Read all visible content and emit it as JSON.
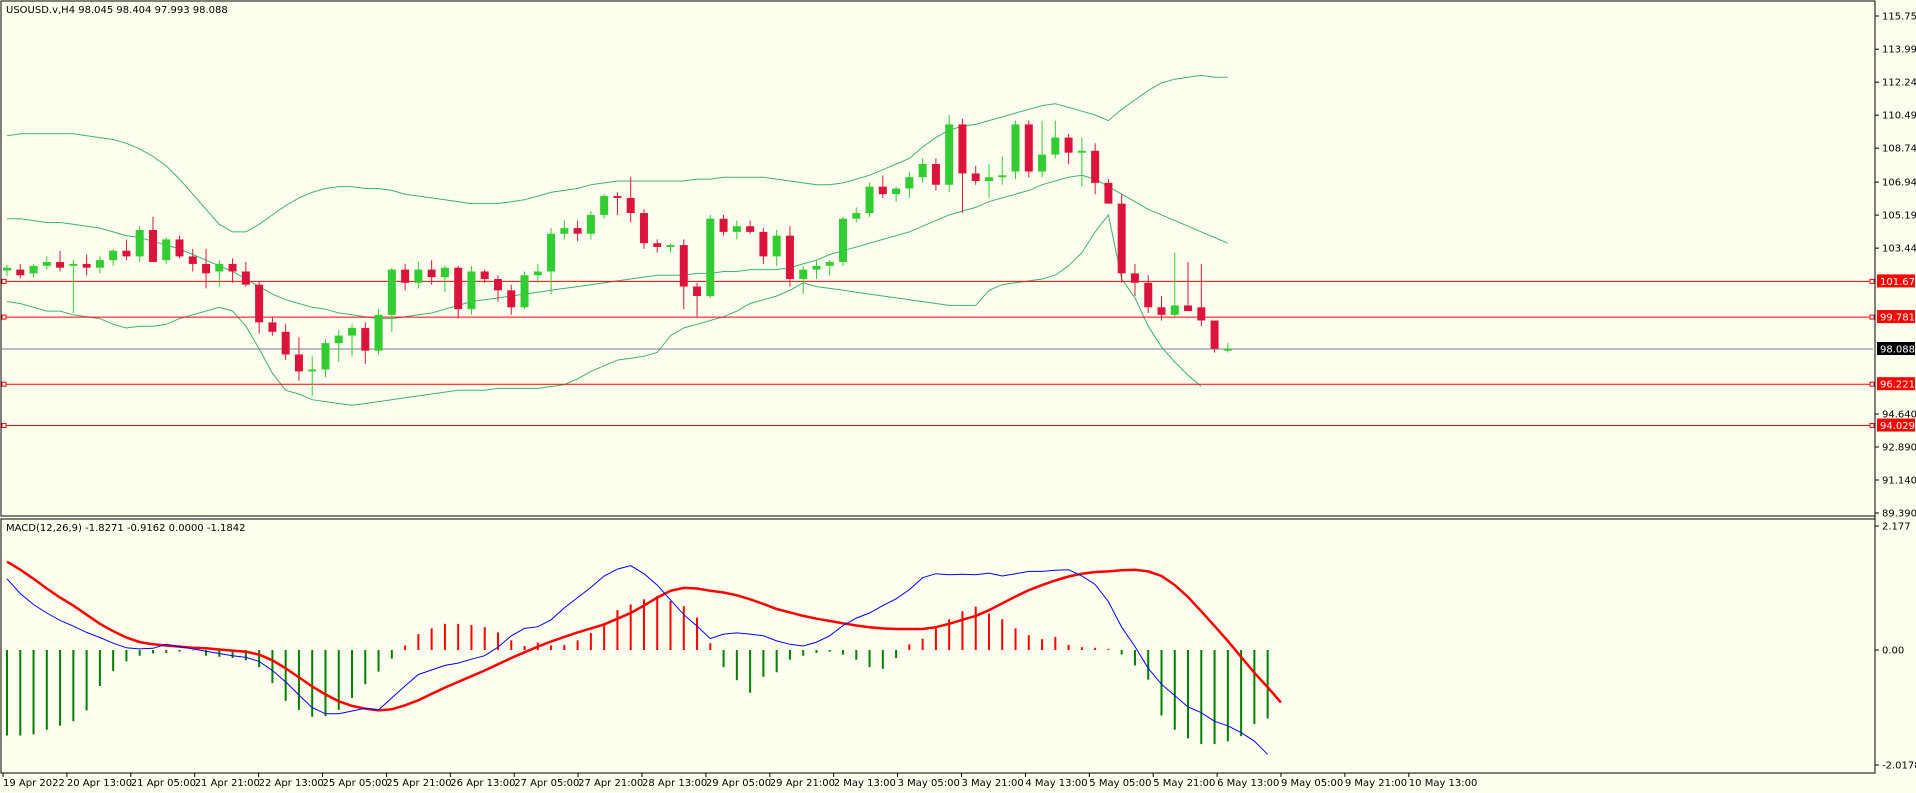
{
  "app": {
    "symbol": "USOUSD.v",
    "timeframe": "H4",
    "ohlc_readout": "98.045 98.404 97.993 98.088",
    "header_text": "USOUSD.v,H4  98.045 98.404 97.993 98.088"
  },
  "colors": {
    "background": "#FFFFF0",
    "bull_candle": "#32CD32",
    "bear_candle": "#DC143C",
    "bollinger": "#3CB371",
    "level_line": "#FF0000",
    "current_price_line": "#708090",
    "macd_line": "#0000FF",
    "signal_line": "#FF0000",
    "hist_negative": "#008000",
    "hist_positive": "#FF0000"
  },
  "price_axis": {
    "labels": [
      "115.750",
      "113.990",
      "112.240",
      "110.490",
      "108.740",
      "106.940",
      "105.190",
      "103.440",
      "101.673",
      "99.781",
      "98.088",
      "96.221",
      "94.640",
      "92.890",
      "91.140",
      "89.390"
    ],
    "range": [
      89.39,
      115.75
    ]
  },
  "levels": [
    {
      "value": 101.673,
      "label": "101.673"
    },
    {
      "value": 99.781,
      "label": "99.781"
    },
    {
      "value": 96.221,
      "label": "96.221"
    },
    {
      "value": 94.029,
      "label": "94.029"
    }
  ],
  "current_price": {
    "value": 98.088,
    "label": "98.088"
  },
  "time_axis": {
    "labels": [
      "19 Apr 2022",
      "20 Apr 13:00",
      "21 Apr 05:00",
      "21 Apr 21:00",
      "22 Apr 13:00",
      "25 Apr 05:00",
      "25 Apr 21:00",
      "26 Apr 13:00",
      "27 Apr 05:00",
      "27 Apr 21:00",
      "28 Apr 13:00",
      "29 Apr 05:00",
      "29 Apr 21:00",
      "2 May 13:00",
      "3 May 05:00",
      "3 May 21:00",
      "4 May 13:00",
      "5 May 05:00",
      "5 May 21:00",
      "6 May 13:00",
      "9 May 05:00",
      "9 May 21:00",
      "10 May 13:00"
    ]
  },
  "macd": {
    "header_text": "MACD(12,26,9) -1.8271 -0.9162 0.0000 -1.1842",
    "axis_labels": [
      "2.177",
      "0.00",
      "-2.0178"
    ],
    "range": [
      -2.0178,
      2.177
    ]
  },
  "chart_data": {
    "type": "candlestick",
    "candles": [
      [
        102.25,
        102.55,
        101.95,
        102.4
      ],
      [
        102.3,
        102.6,
        101.85,
        102.0
      ],
      [
        102.1,
        102.6,
        101.9,
        102.5
      ],
      [
        102.5,
        103.0,
        102.3,
        102.7
      ],
      [
        102.7,
        103.3,
        102.2,
        102.4
      ],
      [
        102.5,
        102.8,
        100.0,
        102.6
      ],
      [
        102.6,
        103.1,
        102.0,
        102.4
      ],
      [
        102.4,
        103.0,
        102.1,
        102.8
      ],
      [
        102.8,
        103.4,
        102.5,
        103.3
      ],
      [
        103.3,
        103.9,
        102.8,
        103.0
      ],
      [
        103.0,
        104.6,
        102.7,
        104.4
      ],
      [
        104.4,
        105.1,
        102.7,
        102.7
      ],
      [
        102.8,
        104.0,
        102.6,
        103.9
      ],
      [
        103.9,
        104.1,
        102.9,
        103.0
      ],
      [
        103.0,
        103.4,
        102.2,
        102.6
      ],
      [
        102.6,
        103.4,
        101.3,
        102.1
      ],
      [
        102.2,
        102.8,
        101.4,
        102.6
      ],
      [
        102.6,
        102.9,
        101.6,
        102.2
      ],
      [
        102.2,
        102.7,
        101.4,
        101.5
      ],
      [
        101.5,
        101.7,
        98.9,
        99.5
      ],
      [
        99.5,
        99.8,
        98.8,
        99.0
      ],
      [
        99.0,
        99.4,
        97.5,
        97.8
      ],
      [
        97.8,
        98.7,
        96.4,
        96.9
      ],
      [
        96.9,
        97.7,
        95.6,
        97.0
      ],
      [
        97.0,
        98.6,
        96.6,
        98.4
      ],
      [
        98.4,
        99.1,
        97.4,
        98.8
      ],
      [
        98.8,
        99.4,
        97.7,
        99.2
      ],
      [
        99.2,
        99.5,
        97.3,
        98.0
      ],
      [
        98.0,
        100.2,
        97.8,
        99.9
      ],
      [
        99.9,
        102.4,
        99.0,
        102.3
      ],
      [
        102.3,
        102.6,
        101.2,
        101.6
      ],
      [
        101.6,
        102.7,
        101.3,
        102.3
      ],
      [
        102.3,
        102.8,
        101.5,
        101.9
      ],
      [
        101.9,
        102.5,
        101.1,
        102.4
      ],
      [
        102.4,
        102.5,
        99.7,
        100.2
      ],
      [
        100.2,
        102.5,
        99.9,
        102.2
      ],
      [
        102.2,
        102.3,
        101.6,
        101.8
      ],
      [
        101.8,
        102.0,
        100.6,
        101.2
      ],
      [
        101.2,
        101.5,
        99.9,
        100.3
      ],
      [
        100.3,
        102.2,
        100.2,
        102.0
      ],
      [
        102.0,
        102.6,
        101.6,
        102.2
      ],
      [
        102.2,
        104.5,
        101.0,
        104.2
      ],
      [
        104.2,
        104.9,
        103.9,
        104.5
      ],
      [
        104.5,
        104.9,
        103.8,
        104.2
      ],
      [
        104.2,
        105.4,
        103.9,
        105.2
      ],
      [
        105.2,
        106.3,
        105.0,
        106.2
      ],
      [
        106.2,
        106.4,
        105.2,
        106.1
      ],
      [
        106.1,
        107.2,
        104.8,
        105.3
      ],
      [
        105.3,
        105.5,
        103.4,
        103.7
      ],
      [
        103.7,
        103.9,
        103.2,
        103.5
      ],
      [
        103.5,
        103.7,
        103.2,
        103.6
      ],
      [
        103.6,
        103.9,
        100.2,
        101.4
      ],
      [
        101.4,
        101.6,
        99.8,
        100.9
      ],
      [
        100.9,
        105.2,
        100.8,
        105.0
      ],
      [
        105.0,
        105.2,
        104.1,
        104.3
      ],
      [
        104.3,
        104.9,
        103.9,
        104.6
      ],
      [
        104.6,
        104.9,
        104.2,
        104.3
      ],
      [
        104.3,
        104.5,
        102.6,
        103.0
      ],
      [
        103.0,
        104.4,
        102.5,
        104.1
      ],
      [
        104.1,
        104.6,
        101.4,
        101.8
      ],
      [
        101.8,
        102.5,
        101.0,
        102.3
      ],
      [
        102.3,
        102.8,
        101.8,
        102.5
      ],
      [
        102.5,
        102.8,
        102.0,
        102.7
      ],
      [
        102.7,
        105.1,
        102.5,
        105.0
      ],
      [
        105.0,
        105.6,
        104.8,
        105.3
      ],
      [
        105.3,
        106.9,
        105.1,
        106.7
      ],
      [
        106.7,
        107.3,
        106.1,
        106.3
      ],
      [
        106.3,
        106.7,
        105.9,
        106.6
      ],
      [
        106.6,
        107.5,
        106.1,
        107.2
      ],
      [
        107.2,
        108.2,
        106.9,
        107.9
      ],
      [
        107.9,
        108.2,
        106.5,
        106.8
      ],
      [
        106.8,
        110.5,
        106.4,
        110.0
      ],
      [
        110.0,
        110.3,
        105.3,
        107.4
      ],
      [
        107.4,
        107.8,
        106.8,
        107.0
      ],
      [
        107.0,
        107.9,
        106.1,
        107.2
      ],
      [
        107.2,
        108.3,
        106.8,
        107.3
      ],
      [
        107.5,
        110.2,
        107.1,
        110.0
      ],
      [
        110.0,
        110.2,
        107.2,
        107.5
      ],
      [
        107.5,
        110.2,
        107.2,
        108.4
      ],
      [
        108.4,
        110.2,
        108.2,
        109.3
      ],
      [
        109.3,
        109.5,
        107.9,
        108.5
      ],
      [
        108.5,
        109.3,
        106.7,
        108.6
      ],
      [
        108.6,
        109.0,
        106.3,
        106.9
      ],
      [
        106.9,
        107.1,
        105.8,
        105.8
      ],
      [
        105.8,
        106.3,
        101.6,
        102.1
      ],
      [
        102.1,
        102.6,
        100.9,
        101.6
      ],
      [
        101.6,
        102.0,
        100.0,
        100.3
      ],
      [
        100.3,
        100.9,
        99.6,
        99.9
      ],
      [
        99.9,
        103.2,
        99.8,
        100.4
      ],
      [
        100.4,
        102.7,
        100.2,
        100.1
      ],
      [
        100.3,
        102.6,
        99.3,
        99.6
      ],
      [
        99.6,
        99.6,
        97.9,
        98.1
      ],
      [
        98.0,
        98.4,
        97.9,
        98.088
      ]
    ],
    "macd": [
      1.25,
      0.99,
      0.8,
      0.65,
      0.52,
      0.42,
      0.31,
      0.22,
      0.12,
      0.04,
      0.02,
      0.03,
      0.1,
      0.06,
      0.02,
      -0.02,
      -0.06,
      -0.1,
      -0.13,
      -0.2,
      -0.36,
      -0.56,
      -0.79,
      -1.01,
      -1.12,
      -1.12,
      -1.07,
      -1.02,
      -1.05,
      -0.84,
      -0.63,
      -0.43,
      -0.35,
      -0.27,
      -0.23,
      -0.16,
      -0.1,
      0.05,
      0.25,
      0.38,
      0.41,
      0.53,
      0.74,
      0.92,
      1.1,
      1.3,
      1.42,
      1.48,
      1.34,
      1.14,
      0.88,
      0.62,
      0.42,
      0.2,
      0.28,
      0.3,
      0.28,
      0.25,
      0.16,
      0.1,
      0.07,
      0.14,
      0.25,
      0.43,
      0.56,
      0.65,
      0.78,
      0.9,
      1.06,
      1.27,
      1.34,
      1.32,
      1.33,
      1.32,
      1.35,
      1.3,
      1.34,
      1.38,
      1.38,
      1.4,
      1.41,
      1.3,
      1.15,
      0.85,
      0.4,
      0.06,
      -0.32,
      -0.6,
      -0.8,
      -1.0,
      -1.1,
      -1.25,
      -1.33,
      -1.45,
      -1.6,
      -1.83
    ],
    "signal": [
      1.55,
      1.41,
      1.25,
      1.08,
      0.92,
      0.78,
      0.62,
      0.46,
      0.33,
      0.22,
      0.14,
      0.1,
      0.08,
      0.06,
      0.04,
      0.03,
      0.01,
      -0.01,
      -0.03,
      -0.08,
      -0.18,
      -0.32,
      -0.48,
      -0.64,
      -0.78,
      -0.9,
      -0.98,
      -1.03,
      -1.06,
      -1.04,
      -0.97,
      -0.88,
      -0.77,
      -0.66,
      -0.56,
      -0.46,
      -0.36,
      -0.25,
      -0.14,
      -0.04,
      0.06,
      0.15,
      0.23,
      0.31,
      0.38,
      0.45,
      0.55,
      0.65,
      0.78,
      0.92,
      1.04,
      1.09,
      1.08,
      1.04,
      1.01,
      0.96,
      0.89,
      0.81,
      0.72,
      0.66,
      0.6,
      0.55,
      0.51,
      0.47,
      0.43,
      0.4,
      0.38,
      0.37,
      0.37,
      0.37,
      0.4,
      0.46,
      0.53,
      0.6,
      0.7,
      0.82,
      0.94,
      1.05,
      1.14,
      1.22,
      1.29,
      1.34,
      1.37,
      1.38,
      1.4,
      1.41,
      1.38,
      1.3,
      1.14,
      0.93,
      0.68,
      0.42,
      0.16,
      -0.12,
      -0.4,
      -0.65,
      -0.92
    ],
    "histogram": [
      -1.5,
      -1.5,
      -1.48,
      -1.4,
      -1.33,
      -1.25,
      -1.06,
      -0.63,
      -0.37,
      -0.2,
      -0.1,
      -0.06,
      -0.05,
      -0.03,
      -0.01,
      -0.1,
      -0.12,
      -0.14,
      -0.18,
      -0.3,
      -0.58,
      -0.89,
      -1.05,
      -1.17,
      -1.16,
      -1.05,
      -0.84,
      -0.6,
      -0.38,
      -0.15,
      0.08,
      0.28,
      0.38,
      0.46,
      0.46,
      0.44,
      0.4,
      0.31,
      0.17,
      0.07,
      0.13,
      0.08,
      0.09,
      0.17,
      0.3,
      0.47,
      0.7,
      0.8,
      0.89,
      0.95,
      0.86,
      0.77,
      0.57,
      0.12,
      -0.3,
      -0.53,
      -0.75,
      -0.47,
      -0.39,
      -0.17,
      -0.1,
      -0.05,
      -0.03,
      -0.08,
      -0.17,
      -0.3,
      -0.33,
      -0.14,
      0.1,
      0.2,
      0.38,
      0.54,
      0.68,
      0.76,
      0.64,
      0.54,
      0.38,
      0.26,
      0.19,
      0.23,
      0.09,
      0.05,
      0.04,
      0.02,
      -0.08,
      -0.27,
      -0.52,
      -1.15,
      -1.4,
      -1.55,
      -1.65,
      -1.65,
      -1.6,
      -1.51,
      -1.3,
      -1.2
    ],
    "bollinger": {
      "start_index": 0,
      "upper": [
        109.4,
        109.5,
        109.5,
        109.5,
        109.5,
        109.5,
        109.4,
        109.3,
        109.2,
        109.0,
        108.7,
        108.3,
        107.8,
        107.1,
        106.3,
        105.5,
        104.7,
        104.3,
        104.3,
        104.7,
        105.2,
        105.7,
        106.1,
        106.4,
        106.6,
        106.7,
        106.7,
        106.6,
        106.6,
        106.5,
        106.3,
        106.2,
        106.1,
        106.0,
        105.9,
        105.8,
        105.8,
        105.8,
        105.9,
        106.0,
        106.2,
        106.4,
        106.5,
        106.6,
        106.8,
        106.9,
        107.0,
        107.0,
        107.0,
        107.0,
        107.0,
        107.0,
        107.1,
        107.1,
        107.2,
        107.2,
        107.2,
        107.2,
        107.1,
        107.0,
        106.9,
        106.8,
        106.8,
        106.9,
        107.1,
        107.3,
        107.6,
        107.9,
        108.2,
        108.8,
        109.3,
        109.7,
        109.9,
        110.0,
        110.2,
        110.4,
        110.6,
        110.8,
        111.0,
        111.1,
        110.9,
        110.7,
        110.5,
        110.2,
        110.8,
        111.3,
        111.8,
        112.2,
        112.4,
        112.5,
        112.6,
        112.5,
        112.5
      ],
      "middle": [
        105.0,
        105.0,
        104.9,
        104.8,
        104.8,
        104.7,
        104.6,
        104.5,
        104.3,
        104.1,
        104.0,
        103.8,
        103.6,
        103.4,
        103.1,
        102.8,
        102.5,
        102.2,
        101.8,
        101.4,
        101.0,
        100.7,
        100.5,
        100.3,
        100.2,
        100.0,
        99.9,
        99.8,
        99.7,
        99.7,
        99.8,
        99.9,
        100.0,
        100.2,
        100.4,
        100.6,
        100.7,
        100.8,
        100.9,
        101.0,
        101.1,
        101.2,
        101.3,
        101.4,
        101.5,
        101.6,
        101.7,
        101.8,
        101.9,
        102.0,
        102.0,
        102.0,
        102.1,
        102.1,
        102.2,
        102.2,
        102.3,
        102.3,
        102.3,
        102.4,
        102.6,
        102.8,
        103.1,
        103.3,
        103.5,
        103.7,
        103.9,
        104.1,
        104.3,
        104.6,
        104.9,
        105.2,
        105.4,
        105.6,
        105.9,
        106.1,
        106.3,
        106.5,
        106.8,
        107.0,
        107.2,
        107.3,
        107.1,
        106.7,
        106.3,
        105.9,
        105.5,
        105.2,
        104.9,
        104.6,
        104.3,
        104.0,
        103.7
      ],
      "lower": [
        100.6,
        100.5,
        100.3,
        100.1,
        100.1,
        99.9,
        99.8,
        99.7,
        99.4,
        99.2,
        99.3,
        99.3,
        99.4,
        99.7,
        99.9,
        100.1,
        100.3,
        100.1,
        99.3,
        98.1,
        96.8,
        95.9,
        95.7,
        95.4,
        95.3,
        95.2,
        95.1,
        95.2,
        95.3,
        95.4,
        95.5,
        95.6,
        95.7,
        95.8,
        95.9,
        95.9,
        95.9,
        96.0,
        96.0,
        96.0,
        96.0,
        96.1,
        96.2,
        96.5,
        96.9,
        97.2,
        97.5,
        97.6,
        97.7,
        97.9,
        98.8,
        99.2,
        99.4,
        99.6,
        99.8,
        100.1,
        100.5,
        100.7,
        100.9,
        101.2,
        101.6,
        101.4,
        101.3,
        101.2,
        101.1,
        101.0,
        100.9,
        100.8,
        100.7,
        100.6,
        100.5,
        100.4,
        100.4,
        100.4,
        101.2,
        101.5,
        101.6,
        101.7,
        101.8,
        102.0,
        102.5,
        103.2,
        104.3,
        105.2,
        101.8,
        100.8,
        99.3,
        98.2,
        97.4,
        96.7,
        96.1
      ],
      "lower_start_index": 0
    }
  }
}
